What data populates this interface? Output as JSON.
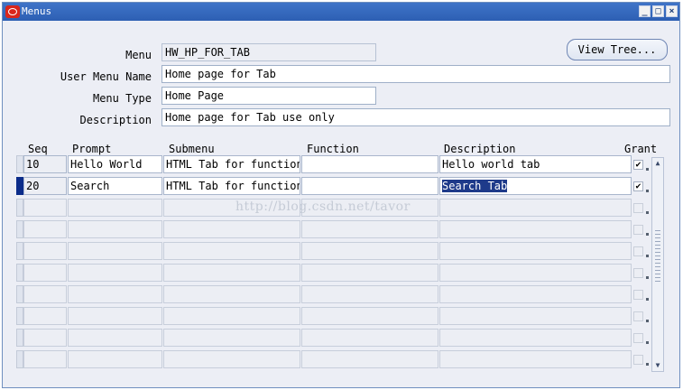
{
  "window": {
    "title": "Menus"
  },
  "icons": {
    "title_logo": "oracle-logo-icon",
    "minimize": "minimize-icon",
    "maximize": "maximize-icon",
    "close": "close-icon"
  },
  "form": {
    "menu_label": "Menu",
    "menu_value": "HW_HP_FOR_TAB",
    "user_menu_name_label": "User Menu Name",
    "user_menu_name_value": "Home page for Tab",
    "menu_type_label": "Menu Type",
    "menu_type_value": "Home Page",
    "description_label": "Description",
    "description_value": "Home page for Tab use only",
    "view_tree_label": "View Tree..."
  },
  "table": {
    "headers": {
      "seq": "Seq",
      "prompt": "Prompt",
      "submenu": "Submenu",
      "function": "Function",
      "description": "Description",
      "grant": "Grant"
    },
    "rows": [
      {
        "seq": "10",
        "prompt": "Hello World",
        "submenu": "HTML Tab for function",
        "function": "",
        "description": "Hello world tab",
        "grant": "✔"
      },
      {
        "seq": "20",
        "prompt": "Search",
        "submenu": "HTML Tab for function",
        "function": "",
        "description": "Search Tab",
        "grant": "✔"
      }
    ]
  },
  "watermark": "http://blog.csdn.net/tavor"
}
